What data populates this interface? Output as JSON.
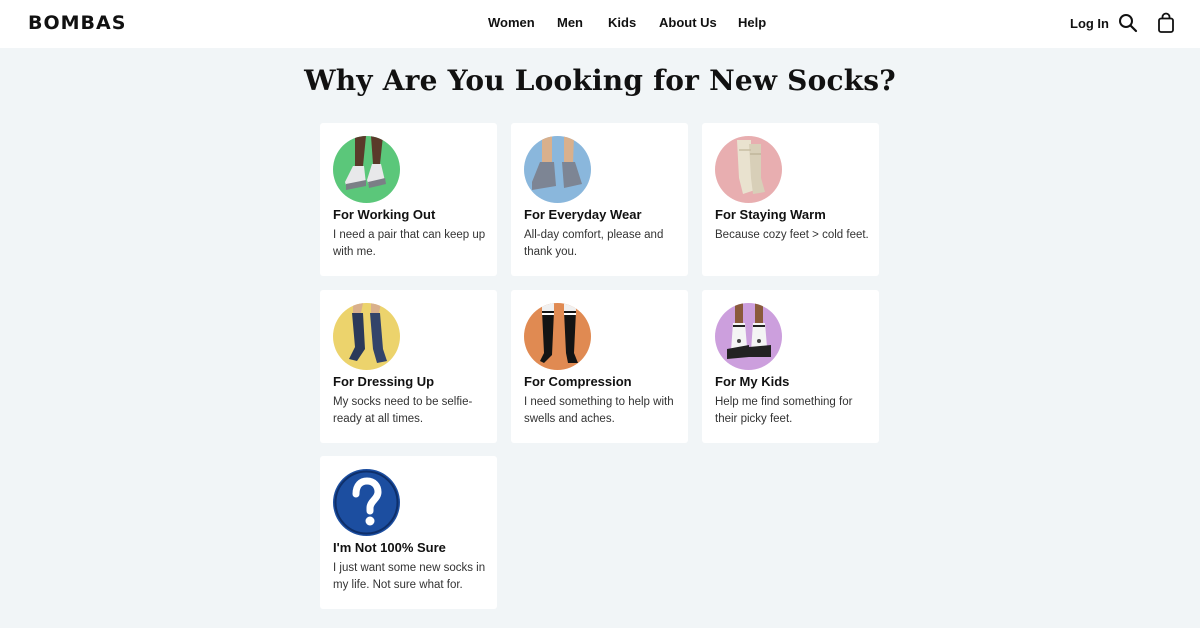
{
  "header": {
    "logo": "BOMBAS",
    "nav": [
      {
        "label": "Women"
      },
      {
        "label": "Men"
      },
      {
        "label": "Kids"
      },
      {
        "label": "About Us"
      },
      {
        "label": "Help"
      }
    ],
    "login_label": "Log In",
    "search_icon": "search-icon",
    "bag_icon": "shopping-bag-icon"
  },
  "page_title": "Why Are You Looking for New Socks?",
  "options": [
    {
      "title": "For Working Out",
      "desc": "I need a pair that can keep up with me.",
      "color": "#5bc77a",
      "icon": "athletic-socks-photo"
    },
    {
      "title": "For Everyday Wear",
      "desc": "All-day comfort, please and thank you.",
      "color": "#8ab7dc",
      "icon": "ankle-socks-photo"
    },
    {
      "title": "For Staying Warm",
      "desc": "Because cozy feet > cold feet.",
      "color": "#e8aeb0",
      "icon": "wool-socks-photo"
    },
    {
      "title": "For Dressing Up",
      "desc": "My socks need to be selfie-ready at all times.",
      "color": "#ecd36c",
      "icon": "dress-socks-photo"
    },
    {
      "title": "For Compression",
      "desc": "I need something to help with swells and aches.",
      "color": "#e08a52",
      "icon": "compression-socks-photo"
    },
    {
      "title": "For My Kids",
      "desc": "Help me find something for their picky feet.",
      "color": "#cc9fdd",
      "icon": "kids-socks-photo"
    },
    {
      "title": "I'm Not 100% Sure",
      "desc": "I just want some new socks in my life. Not sure what for.",
      "color": "#1c4ea0",
      "icon": "question-mark-icon"
    }
  ]
}
